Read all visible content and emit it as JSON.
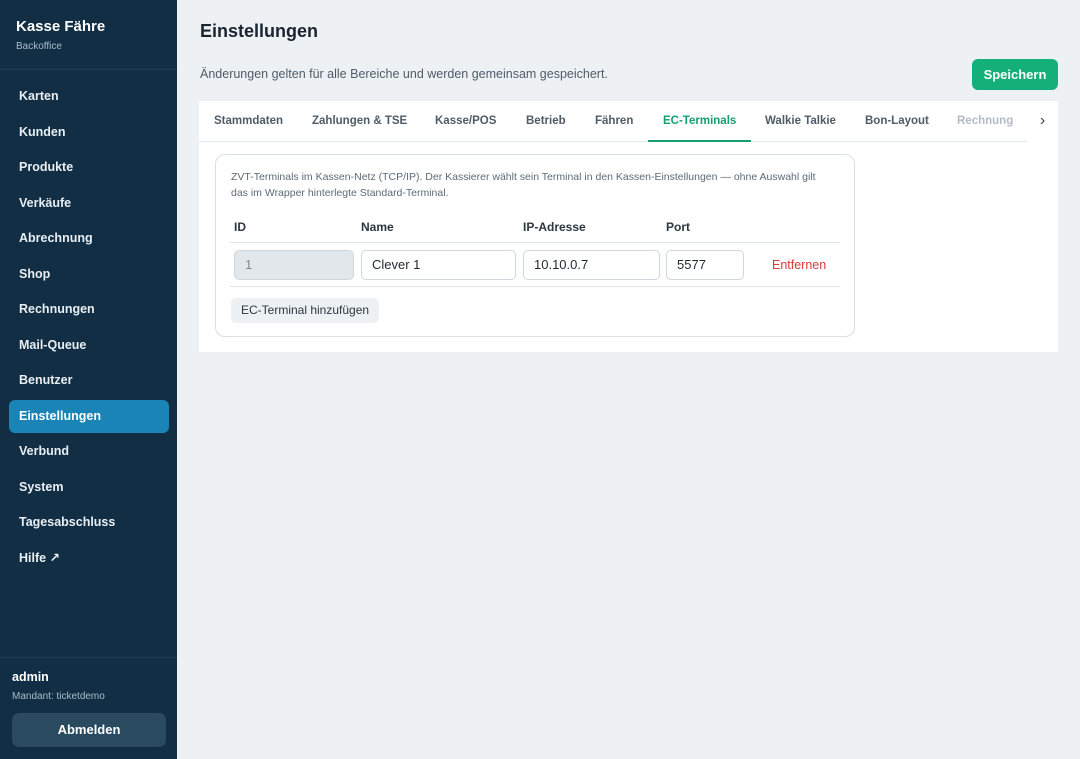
{
  "sidebar": {
    "brand_title": "Kasse Fähre",
    "brand_subtitle": "Backoffice",
    "items": [
      {
        "label": "Karten"
      },
      {
        "label": "Kunden"
      },
      {
        "label": "Produkte"
      },
      {
        "label": "Verkäufe"
      },
      {
        "label": "Abrechnung"
      },
      {
        "label": "Shop"
      },
      {
        "label": "Rechnungen"
      },
      {
        "label": "Mail-Queue"
      },
      {
        "label": "Benutzer"
      },
      {
        "label": "Einstellungen"
      },
      {
        "label": "Verbund"
      },
      {
        "label": "System"
      },
      {
        "label": "Tagesabschluss"
      },
      {
        "label": "Hilfe ↗"
      }
    ],
    "active_item": "Einstellungen",
    "user": {
      "name": "admin",
      "tenant": "Mandant: ticketdemo"
    },
    "logout_label": "Abmelden"
  },
  "header": {
    "title": "Einstellungen",
    "hint": "Änderungen gelten für alle Bereiche und werden gemeinsam gespeichert.",
    "save_label": "Speichern"
  },
  "tabs": [
    {
      "label": "Stammdaten"
    },
    {
      "label": "Zahlungen & TSE"
    },
    {
      "label": "Kasse/POS"
    },
    {
      "label": "Betrieb"
    },
    {
      "label": "Fähren"
    },
    {
      "label": "EC-Terminals"
    },
    {
      "label": "Walkie Talkie"
    },
    {
      "label": "Bon-Layout"
    },
    {
      "label": "Rechnung"
    }
  ],
  "active_tab": "EC-Terminals",
  "ec_terminals": {
    "description": "ZVT-Terminals im Kassen-Netz (TCP/IP). Der Kassierer wählt sein Terminal in den Kassen-Einstellungen — ohne Auswahl gilt das im Wrapper hinterlegte Standard-Terminal.",
    "columns": {
      "id": "ID",
      "name": "Name",
      "ip": "IP-Adresse",
      "port": "Port"
    },
    "rows": [
      {
        "id": "1",
        "name": "Clever 1",
        "ip": "10.10.0.7",
        "port": "5577",
        "remove_label": "Entfernen"
      }
    ],
    "add_label": "EC-Terminal hinzufügen"
  },
  "colors": {
    "sidebar_bg": "#112e44",
    "active_nav": "#1a84b6",
    "accent_green": "#15b07a",
    "danger_red": "#d93a3a"
  },
  "icons": {
    "tab_scroll": "chevron-right-icon"
  }
}
